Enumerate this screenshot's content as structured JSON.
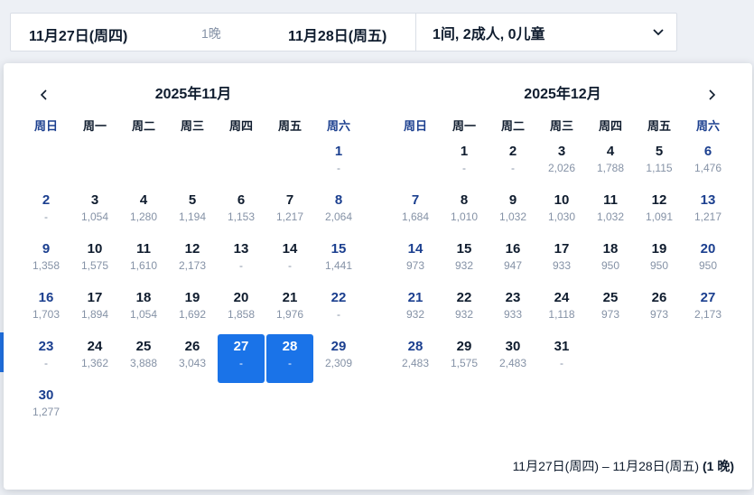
{
  "search_bar": {
    "checkin": "11月27日(周四)",
    "nights": "1晚",
    "checkout": "11月28日(周五)",
    "guests": "1间, 2成人, 0儿童",
    "dropdown_icon": "chevron-down-icon"
  },
  "calendar": {
    "prev_icon": "chevron-left-icon",
    "next_icon": "chevron-right-icon",
    "weekdays": [
      "周日",
      "周一",
      "周二",
      "周三",
      "周四",
      "周五",
      "周六"
    ],
    "months": [
      {
        "title": "2025年11月",
        "days": [
          null,
          null,
          null,
          null,
          null,
          null,
          {
            "day": "1",
            "price": "-"
          },
          {
            "day": "2",
            "price": "-"
          },
          {
            "day": "3",
            "price": "1,054"
          },
          {
            "day": "4",
            "price": "1,280"
          },
          {
            "day": "5",
            "price": "1,194"
          },
          {
            "day": "6",
            "price": "1,153"
          },
          {
            "day": "7",
            "price": "1,217"
          },
          {
            "day": "8",
            "price": "2,064"
          },
          {
            "day": "9",
            "price": "1,358"
          },
          {
            "day": "10",
            "price": "1,575"
          },
          {
            "day": "11",
            "price": "1,610"
          },
          {
            "day": "12",
            "price": "2,173"
          },
          {
            "day": "13",
            "price": "-"
          },
          {
            "day": "14",
            "price": "-"
          },
          {
            "day": "15",
            "price": "1,441"
          },
          {
            "day": "16",
            "price": "1,703"
          },
          {
            "day": "17",
            "price": "1,894"
          },
          {
            "day": "18",
            "price": "1,054"
          },
          {
            "day": "19",
            "price": "1,692"
          },
          {
            "day": "20",
            "price": "1,858"
          },
          {
            "day": "21",
            "price": "1,976"
          },
          {
            "day": "22",
            "price": "-"
          },
          {
            "day": "23",
            "price": "-"
          },
          {
            "day": "24",
            "price": "1,362"
          },
          {
            "day": "25",
            "price": "3,888"
          },
          {
            "day": "26",
            "price": "3,043"
          },
          {
            "day": "27",
            "price": "-",
            "selected": true
          },
          {
            "day": "28",
            "price": "-",
            "selected": true
          },
          {
            "day": "29",
            "price": "2,309"
          },
          {
            "day": "30",
            "price": "1,277"
          }
        ]
      },
      {
        "title": "2025年12月",
        "days": [
          null,
          {
            "day": "1",
            "price": "-"
          },
          {
            "day": "2",
            "price": "-"
          },
          {
            "day": "3",
            "price": "2,026"
          },
          {
            "day": "4",
            "price": "1,788"
          },
          {
            "day": "5",
            "price": "1,115"
          },
          {
            "day": "6",
            "price": "1,476"
          },
          {
            "day": "7",
            "price": "1,684"
          },
          {
            "day": "8",
            "price": "1,010"
          },
          {
            "day": "9",
            "price": "1,032"
          },
          {
            "day": "10",
            "price": "1,030"
          },
          {
            "day": "11",
            "price": "1,032"
          },
          {
            "day": "12",
            "price": "1,091"
          },
          {
            "day": "13",
            "price": "1,217"
          },
          {
            "day": "14",
            "price": "973"
          },
          {
            "day": "15",
            "price": "932"
          },
          {
            "day": "16",
            "price": "947"
          },
          {
            "day": "17",
            "price": "933"
          },
          {
            "day": "18",
            "price": "950"
          },
          {
            "day": "19",
            "price": "950"
          },
          {
            "day": "20",
            "price": "950"
          },
          {
            "day": "21",
            "price": "932"
          },
          {
            "day": "22",
            "price": "932"
          },
          {
            "day": "23",
            "price": "933"
          },
          {
            "day": "24",
            "price": "1,118"
          },
          {
            "day": "25",
            "price": "973"
          },
          {
            "day": "26",
            "price": "973"
          },
          {
            "day": "27",
            "price": "2,173"
          },
          {
            "day": "28",
            "price": "2,483"
          },
          {
            "day": "29",
            "price": "1,575"
          },
          {
            "day": "30",
            "price": "2,483"
          },
          {
            "day": "31",
            "price": "-"
          }
        ]
      }
    ],
    "summary_range": "11月27日(周四) – 11月28日(周五)",
    "summary_nights": "(1 晚)"
  },
  "colors": {
    "selected": "#1a73e8",
    "weekend": "#1b3f8f",
    "price": "#8592a6",
    "text": "#0f1c2e"
  }
}
